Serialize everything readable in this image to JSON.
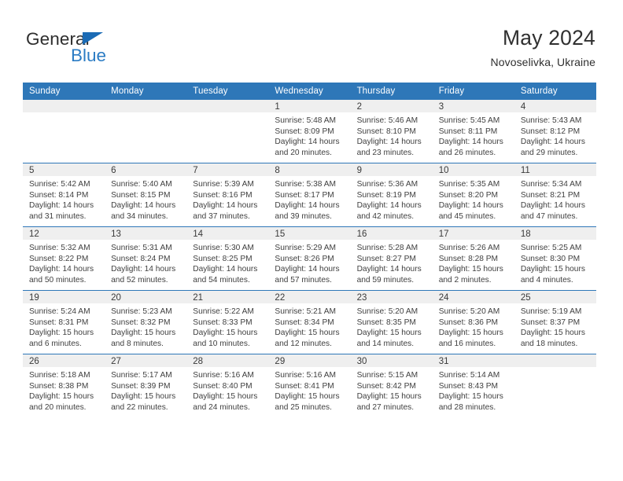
{
  "brand": {
    "name_part1": "General",
    "name_part2": "Blue",
    "logo_icon": "triangle-icon",
    "color_primary": "#2b7cc4",
    "color_text": "#2e2e2e"
  },
  "header": {
    "title": "May 2024",
    "subtitle": "Novoselivka, Ukraine"
  },
  "theme": {
    "header_bg": "#2e77b8",
    "header_text": "#ffffff",
    "daynum_band_bg": "#efefef",
    "cell_bg": "#ffffff",
    "row_separator": "#2e77b8"
  },
  "calendar": {
    "month": "May",
    "year": "2024",
    "location": "Novoselivka, Ukraine",
    "weekday_headers": [
      "Sunday",
      "Monday",
      "Tuesday",
      "Wednesday",
      "Thursday",
      "Friday",
      "Saturday"
    ],
    "weeks": [
      [
        {
          "day": "",
          "empty": true,
          "sunrise": "",
          "sunset": "",
          "daylight_line1": "",
          "daylight_line2": ""
        },
        {
          "day": "",
          "empty": true,
          "sunrise": "",
          "sunset": "",
          "daylight_line1": "",
          "daylight_line2": ""
        },
        {
          "day": "",
          "empty": true,
          "sunrise": "",
          "sunset": "",
          "daylight_line1": "",
          "daylight_line2": ""
        },
        {
          "day": "1",
          "empty": false,
          "sunrise": "Sunrise: 5:48 AM",
          "sunset": "Sunset: 8:09 PM",
          "daylight_line1": "Daylight: 14 hours",
          "daylight_line2": "and 20 minutes."
        },
        {
          "day": "2",
          "empty": false,
          "sunrise": "Sunrise: 5:46 AM",
          "sunset": "Sunset: 8:10 PM",
          "daylight_line1": "Daylight: 14 hours",
          "daylight_line2": "and 23 minutes."
        },
        {
          "day": "3",
          "empty": false,
          "sunrise": "Sunrise: 5:45 AM",
          "sunset": "Sunset: 8:11 PM",
          "daylight_line1": "Daylight: 14 hours",
          "daylight_line2": "and 26 minutes."
        },
        {
          "day": "4",
          "empty": false,
          "sunrise": "Sunrise: 5:43 AM",
          "sunset": "Sunset: 8:12 PM",
          "daylight_line1": "Daylight: 14 hours",
          "daylight_line2": "and 29 minutes."
        }
      ],
      [
        {
          "day": "5",
          "empty": false,
          "sunrise": "Sunrise: 5:42 AM",
          "sunset": "Sunset: 8:14 PM",
          "daylight_line1": "Daylight: 14 hours",
          "daylight_line2": "and 31 minutes."
        },
        {
          "day": "6",
          "empty": false,
          "sunrise": "Sunrise: 5:40 AM",
          "sunset": "Sunset: 8:15 PM",
          "daylight_line1": "Daylight: 14 hours",
          "daylight_line2": "and 34 minutes."
        },
        {
          "day": "7",
          "empty": false,
          "sunrise": "Sunrise: 5:39 AM",
          "sunset": "Sunset: 8:16 PM",
          "daylight_line1": "Daylight: 14 hours",
          "daylight_line2": "and 37 minutes."
        },
        {
          "day": "8",
          "empty": false,
          "sunrise": "Sunrise: 5:38 AM",
          "sunset": "Sunset: 8:17 PM",
          "daylight_line1": "Daylight: 14 hours",
          "daylight_line2": "and 39 minutes."
        },
        {
          "day": "9",
          "empty": false,
          "sunrise": "Sunrise: 5:36 AM",
          "sunset": "Sunset: 8:19 PM",
          "daylight_line1": "Daylight: 14 hours",
          "daylight_line2": "and 42 minutes."
        },
        {
          "day": "10",
          "empty": false,
          "sunrise": "Sunrise: 5:35 AM",
          "sunset": "Sunset: 8:20 PM",
          "daylight_line1": "Daylight: 14 hours",
          "daylight_line2": "and 45 minutes."
        },
        {
          "day": "11",
          "empty": false,
          "sunrise": "Sunrise: 5:34 AM",
          "sunset": "Sunset: 8:21 PM",
          "daylight_line1": "Daylight: 14 hours",
          "daylight_line2": "and 47 minutes."
        }
      ],
      [
        {
          "day": "12",
          "empty": false,
          "sunrise": "Sunrise: 5:32 AM",
          "sunset": "Sunset: 8:22 PM",
          "daylight_line1": "Daylight: 14 hours",
          "daylight_line2": "and 50 minutes."
        },
        {
          "day": "13",
          "empty": false,
          "sunrise": "Sunrise: 5:31 AM",
          "sunset": "Sunset: 8:24 PM",
          "daylight_line1": "Daylight: 14 hours",
          "daylight_line2": "and 52 minutes."
        },
        {
          "day": "14",
          "empty": false,
          "sunrise": "Sunrise: 5:30 AM",
          "sunset": "Sunset: 8:25 PM",
          "daylight_line1": "Daylight: 14 hours",
          "daylight_line2": "and 54 minutes."
        },
        {
          "day": "15",
          "empty": false,
          "sunrise": "Sunrise: 5:29 AM",
          "sunset": "Sunset: 8:26 PM",
          "daylight_line1": "Daylight: 14 hours",
          "daylight_line2": "and 57 minutes."
        },
        {
          "day": "16",
          "empty": false,
          "sunrise": "Sunrise: 5:28 AM",
          "sunset": "Sunset: 8:27 PM",
          "daylight_line1": "Daylight: 14 hours",
          "daylight_line2": "and 59 minutes."
        },
        {
          "day": "17",
          "empty": false,
          "sunrise": "Sunrise: 5:26 AM",
          "sunset": "Sunset: 8:28 PM",
          "daylight_line1": "Daylight: 15 hours",
          "daylight_line2": "and 2 minutes."
        },
        {
          "day": "18",
          "empty": false,
          "sunrise": "Sunrise: 5:25 AM",
          "sunset": "Sunset: 8:30 PM",
          "daylight_line1": "Daylight: 15 hours",
          "daylight_line2": "and 4 minutes."
        }
      ],
      [
        {
          "day": "19",
          "empty": false,
          "sunrise": "Sunrise: 5:24 AM",
          "sunset": "Sunset: 8:31 PM",
          "daylight_line1": "Daylight: 15 hours",
          "daylight_line2": "and 6 minutes."
        },
        {
          "day": "20",
          "empty": false,
          "sunrise": "Sunrise: 5:23 AM",
          "sunset": "Sunset: 8:32 PM",
          "daylight_line1": "Daylight: 15 hours",
          "daylight_line2": "and 8 minutes."
        },
        {
          "day": "21",
          "empty": false,
          "sunrise": "Sunrise: 5:22 AM",
          "sunset": "Sunset: 8:33 PM",
          "daylight_line1": "Daylight: 15 hours",
          "daylight_line2": "and 10 minutes."
        },
        {
          "day": "22",
          "empty": false,
          "sunrise": "Sunrise: 5:21 AM",
          "sunset": "Sunset: 8:34 PM",
          "daylight_line1": "Daylight: 15 hours",
          "daylight_line2": "and 12 minutes."
        },
        {
          "day": "23",
          "empty": false,
          "sunrise": "Sunrise: 5:20 AM",
          "sunset": "Sunset: 8:35 PM",
          "daylight_line1": "Daylight: 15 hours",
          "daylight_line2": "and 14 minutes."
        },
        {
          "day": "24",
          "empty": false,
          "sunrise": "Sunrise: 5:20 AM",
          "sunset": "Sunset: 8:36 PM",
          "daylight_line1": "Daylight: 15 hours",
          "daylight_line2": "and 16 minutes."
        },
        {
          "day": "25",
          "empty": false,
          "sunrise": "Sunrise: 5:19 AM",
          "sunset": "Sunset: 8:37 PM",
          "daylight_line1": "Daylight: 15 hours",
          "daylight_line2": "and 18 minutes."
        }
      ],
      [
        {
          "day": "26",
          "empty": false,
          "sunrise": "Sunrise: 5:18 AM",
          "sunset": "Sunset: 8:38 PM",
          "daylight_line1": "Daylight: 15 hours",
          "daylight_line2": "and 20 minutes."
        },
        {
          "day": "27",
          "empty": false,
          "sunrise": "Sunrise: 5:17 AM",
          "sunset": "Sunset: 8:39 PM",
          "daylight_line1": "Daylight: 15 hours",
          "daylight_line2": "and 22 minutes."
        },
        {
          "day": "28",
          "empty": false,
          "sunrise": "Sunrise: 5:16 AM",
          "sunset": "Sunset: 8:40 PM",
          "daylight_line1": "Daylight: 15 hours",
          "daylight_line2": "and 24 minutes."
        },
        {
          "day": "29",
          "empty": false,
          "sunrise": "Sunrise: 5:16 AM",
          "sunset": "Sunset: 8:41 PM",
          "daylight_line1": "Daylight: 15 hours",
          "daylight_line2": "and 25 minutes."
        },
        {
          "day": "30",
          "empty": false,
          "sunrise": "Sunrise: 5:15 AM",
          "sunset": "Sunset: 8:42 PM",
          "daylight_line1": "Daylight: 15 hours",
          "daylight_line2": "and 27 minutes."
        },
        {
          "day": "31",
          "empty": false,
          "sunrise": "Sunrise: 5:14 AM",
          "sunset": "Sunset: 8:43 PM",
          "daylight_line1": "Daylight: 15 hours",
          "daylight_line2": "and 28 minutes."
        },
        {
          "day": "",
          "empty": true,
          "sunrise": "",
          "sunset": "",
          "daylight_line1": "",
          "daylight_line2": ""
        }
      ]
    ]
  }
}
